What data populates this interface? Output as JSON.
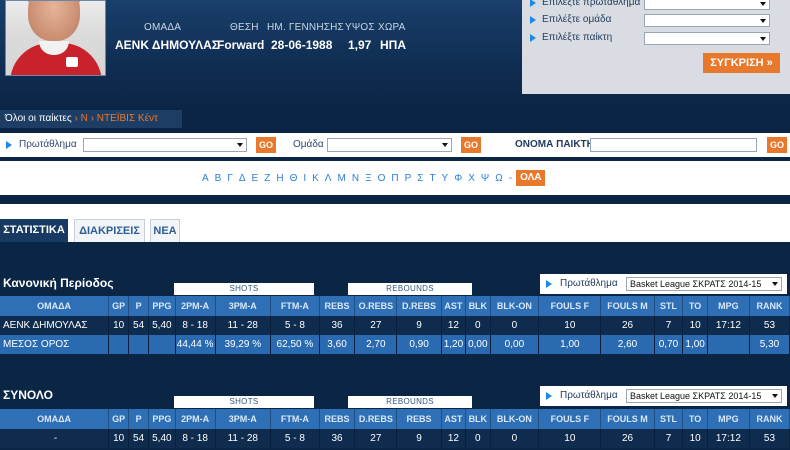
{
  "player": {
    "labels": [
      "ΟΜΑΔΑ",
      "ΘΕΣΗ",
      "ΗΜ. ΓΕΝΝΗΣΗΣ",
      "ΥΨΟΣ",
      "ΧΩΡΑ"
    ],
    "values": [
      "ΑΕΝΚ ΔΗΜΟΥΛΑΣ",
      "Forward",
      "28-06-1988",
      "1,97",
      "ΗΠΑ"
    ]
  },
  "compare": {
    "fields": [
      "Επιλέξτε πρωτάθλημα",
      "Επιλέξτε ομάδα",
      "Επιλέξτε παίκτη"
    ],
    "button": "ΣΥΓΚΡΙΣΗ »"
  },
  "breadcrumb": {
    "root": "Όλοι οι παίκτες",
    "sep1": " › ",
    "letter": "Ν",
    "sep2": " › ",
    "current": "ΝΤΕΪΒΙΣ Κέντ"
  },
  "filters": {
    "championship_label": "Πρωτάθλημα",
    "team_label": "Ομάδα",
    "go": "GO",
    "name_label": "ΟΝΟΜΑ ΠΑΙΚΤΗ"
  },
  "alphabet": {
    "letters": [
      "Α",
      "Β",
      "Γ",
      "Δ",
      "Ε",
      "Ζ",
      "Η",
      "Θ",
      "Ι",
      "Κ",
      "Λ",
      "Μ",
      "Ν",
      "Ξ",
      "Ο",
      "Π",
      "Ρ",
      "Σ",
      "Τ",
      "Υ",
      "Φ",
      "Χ",
      "Ψ",
      "Ω"
    ],
    "dash": "-",
    "all": "ΟΛΑ"
  },
  "tabs": [
    "ΣΤΑΤΙΣΤΙΚΑ",
    "ΔΙΑΚΡΙΣΕΙΣ",
    "ΝΕΑ"
  ],
  "regular": {
    "title": "Κανονική Περίοδος",
    "shots_label": "SHOTS",
    "rebounds_label": "REBOUNDS",
    "champ_label": "Πρωτάθλημα",
    "champ_value": "Basket League ΣΚΡΑΤΣ 2014-15",
    "headers": [
      "ΟΜΑΔΑ",
      "GP",
      "P",
      "PPG",
      "2PM-A",
      "3PM-A",
      "FTM-A",
      "REBS",
      "O.REBS",
      "D.REBS",
      "AST",
      "BLK",
      "BLK-ON",
      "FOULS F",
      "FOULS M",
      "STL",
      "TO",
      "MPG",
      "RANK"
    ],
    "rows": [
      [
        "ΑΕΝΚ ΔΗΜΟΥΛΑΣ",
        "10",
        "54",
        "5,40",
        "8 - 18",
        "11 - 28",
        "5 - 8",
        "36",
        "27",
        "9",
        "12",
        "0",
        "0",
        "10",
        "26",
        "7",
        "10",
        "17:12",
        "53"
      ],
      [
        "ΜΕΣΟΣ ΟΡΟΣ",
        "",
        "",
        "",
        "44,44 %",
        "39,29 %",
        "62,50 %",
        "3,60",
        "2,70",
        "0,90",
        "1,20",
        "0,00",
        "0,00",
        "1,00",
        "2,60",
        "0,70",
        "1,00",
        "",
        "5,30"
      ]
    ]
  },
  "total": {
    "title": "ΣΥΝΟΛΟ",
    "shots_label": "SHOTS",
    "rebounds_label": "REBOUNDS",
    "champ_label": "Πρωτάθλημα",
    "champ_value": "Basket League ΣΚΡΑΤΣ 2014-15",
    "headers": [
      "ΟΜΑΔΑ",
      "GP",
      "P",
      "PPG",
      "2PM-A",
      "3PM-A",
      "FTM-A",
      "REBS",
      "D.REBS",
      "REBS",
      "AST",
      "BLK",
      "BLK-ON",
      "FOULS F",
      "FOULS M",
      "STL",
      "TO",
      "MPG",
      "RANK"
    ],
    "rows": [
      [
        "-",
        "10",
        "54",
        "5,40",
        "8 - 18",
        "11 - 28",
        "5 - 8",
        "36",
        "27",
        "9",
        "12",
        "0",
        "0",
        "10",
        "26",
        "7",
        "10",
        "17:12",
        "53"
      ]
    ]
  },
  "colors": {
    "navy": "#0b2545",
    "accent": "#e8792c",
    "table_header": "#2f6fb5",
    "link": "#2e7ed6"
  }
}
